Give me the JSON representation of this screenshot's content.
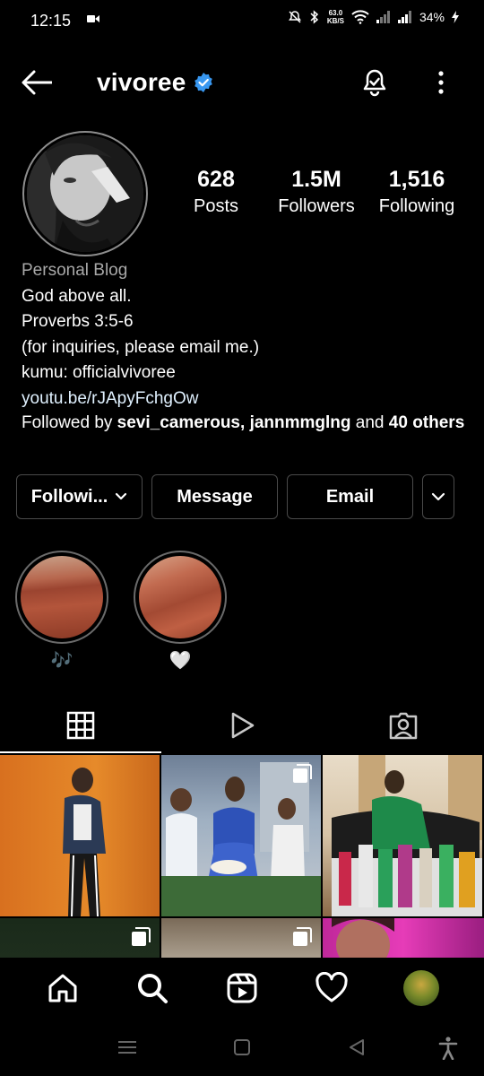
{
  "status_bar": {
    "time": "12:15",
    "net_speed_value": "63.0",
    "net_speed_unit": "KB/S",
    "battery": "34%"
  },
  "header": {
    "username": "vivoree",
    "verified_icon": "verified-badge-icon",
    "accent": "#3897f0"
  },
  "stats": [
    {
      "value": "628",
      "label": "Posts"
    },
    {
      "value": "1.5M",
      "label": "Followers"
    },
    {
      "value": "1,516",
      "label": "Following"
    }
  ],
  "bio": {
    "category": "Personal Blog",
    "lines": [
      "God above all.",
      "Proverbs 3:5-6",
      "(for inquiries, please email me.)",
      "kumu: officialvivoree"
    ],
    "link": "youtu.be/rJApyFchgOw",
    "followed_by_prefix": "Followed by ",
    "followed_by_user1": "sevi_camerous",
    "followed_by_sep": ", ",
    "followed_by_user2": "jannmmglng",
    "followed_by_and": " and ",
    "followed_by_others": "40 others"
  },
  "actions": {
    "following_label": "Followi...",
    "message_label": "Message",
    "email_label": "Email"
  },
  "highlights": [
    {
      "label": "🎶"
    },
    {
      "label": "🤍"
    }
  ],
  "tabs": [
    "grid-icon",
    "reels-icon",
    "tagged-icon"
  ]
}
